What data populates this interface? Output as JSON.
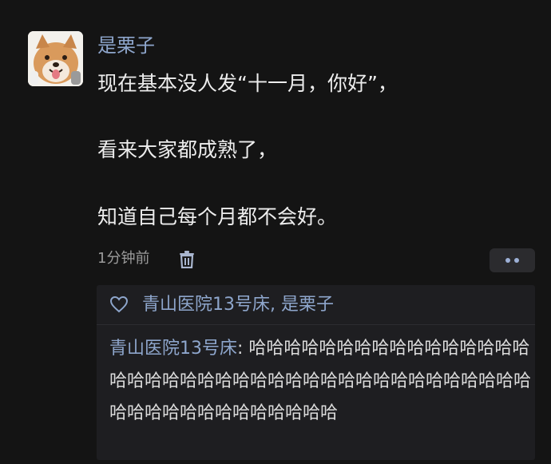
{
  "post": {
    "author": "是栗子",
    "lines": [
      "现在基本没人发“十一月，你好”，",
      "看来大家都成熟了，",
      "知道自己每个月都不会好。"
    ],
    "timestamp": "1分钟前"
  },
  "interactions": {
    "likes_text": "青山医院13号床, 是栗子",
    "reply_author": "青山医院13号床",
    "reply_separator": ": ",
    "reply_text": "哈哈哈哈哈哈哈哈哈哈哈哈哈哈哈哈哈哈哈哈哈哈哈哈哈哈哈哈哈哈哈哈哈哈哈哈哈哈哈哈哈哈哈哈哈哈哈哈哈哈哈哈哈"
  },
  "icons": {
    "avatar": "shiba-dog-avatar",
    "delete": "trash-icon",
    "more": "more-dots-icon",
    "like": "heart-icon"
  },
  "colors": {
    "background": "#141414",
    "link_blue": "#8ea6cc",
    "panel": "#1e1e21",
    "meta_grey": "#9b9b9b"
  }
}
